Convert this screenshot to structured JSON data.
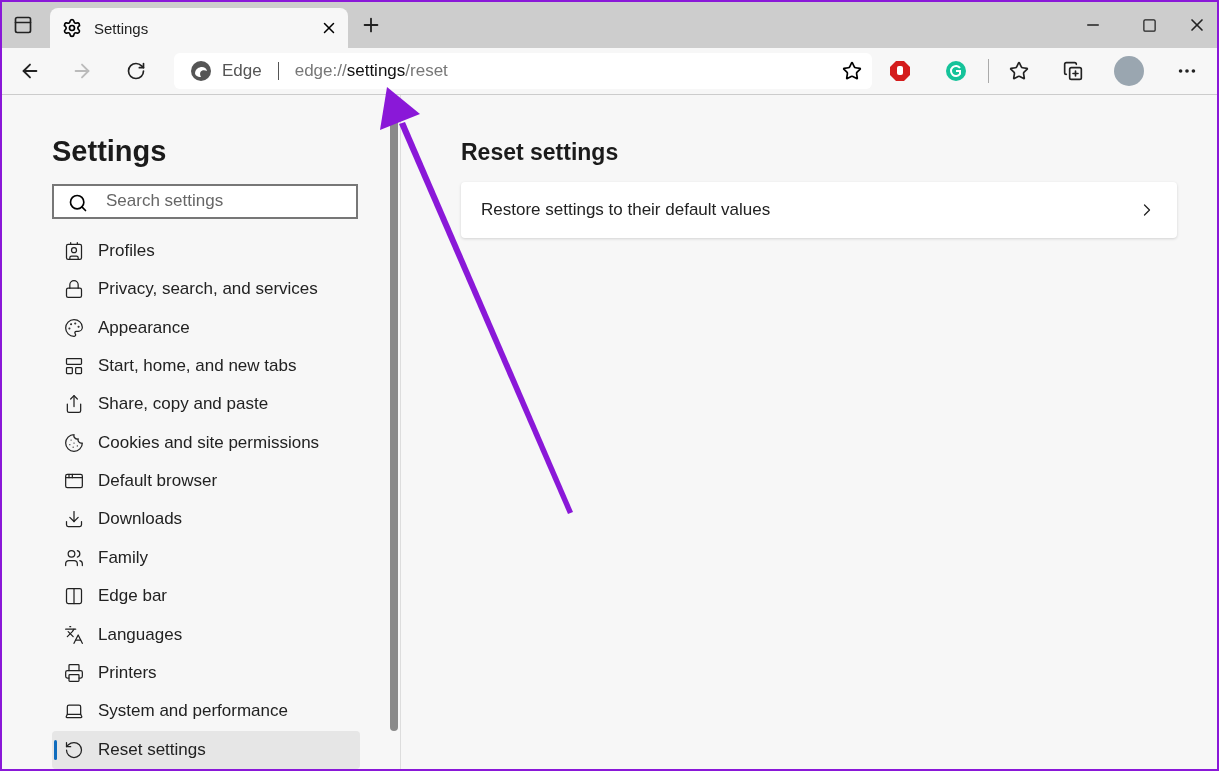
{
  "tab": {
    "title": "Settings",
    "selected": true
  },
  "address_bar": {
    "site_label": "Edge",
    "url_scheme": "edge://",
    "url_host": "settings",
    "url_path": "/reset"
  },
  "sidebar": {
    "title": "Settings",
    "search": {
      "placeholder": "Search settings"
    },
    "items": [
      {
        "label": "Profiles",
        "selected": false
      },
      {
        "label": "Privacy, search, and services",
        "selected": false
      },
      {
        "label": "Appearance",
        "selected": false
      },
      {
        "label": "Start, home, and new tabs",
        "selected": false
      },
      {
        "label": "Share, copy and paste",
        "selected": false
      },
      {
        "label": "Cookies and site permissions",
        "selected": false
      },
      {
        "label": "Default browser",
        "selected": false
      },
      {
        "label": "Downloads",
        "selected": false
      },
      {
        "label": "Family",
        "selected": false
      },
      {
        "label": "Edge bar",
        "selected": false
      },
      {
        "label": "Languages",
        "selected": false
      },
      {
        "label": "Printers",
        "selected": false
      },
      {
        "label": "System and performance",
        "selected": false
      },
      {
        "label": "Reset settings",
        "selected": true
      }
    ]
  },
  "main": {
    "title": "Reset settings",
    "rows": [
      {
        "label": "Restore settings to their default values"
      }
    ]
  },
  "annotation": {
    "kind": "arrow"
  }
}
